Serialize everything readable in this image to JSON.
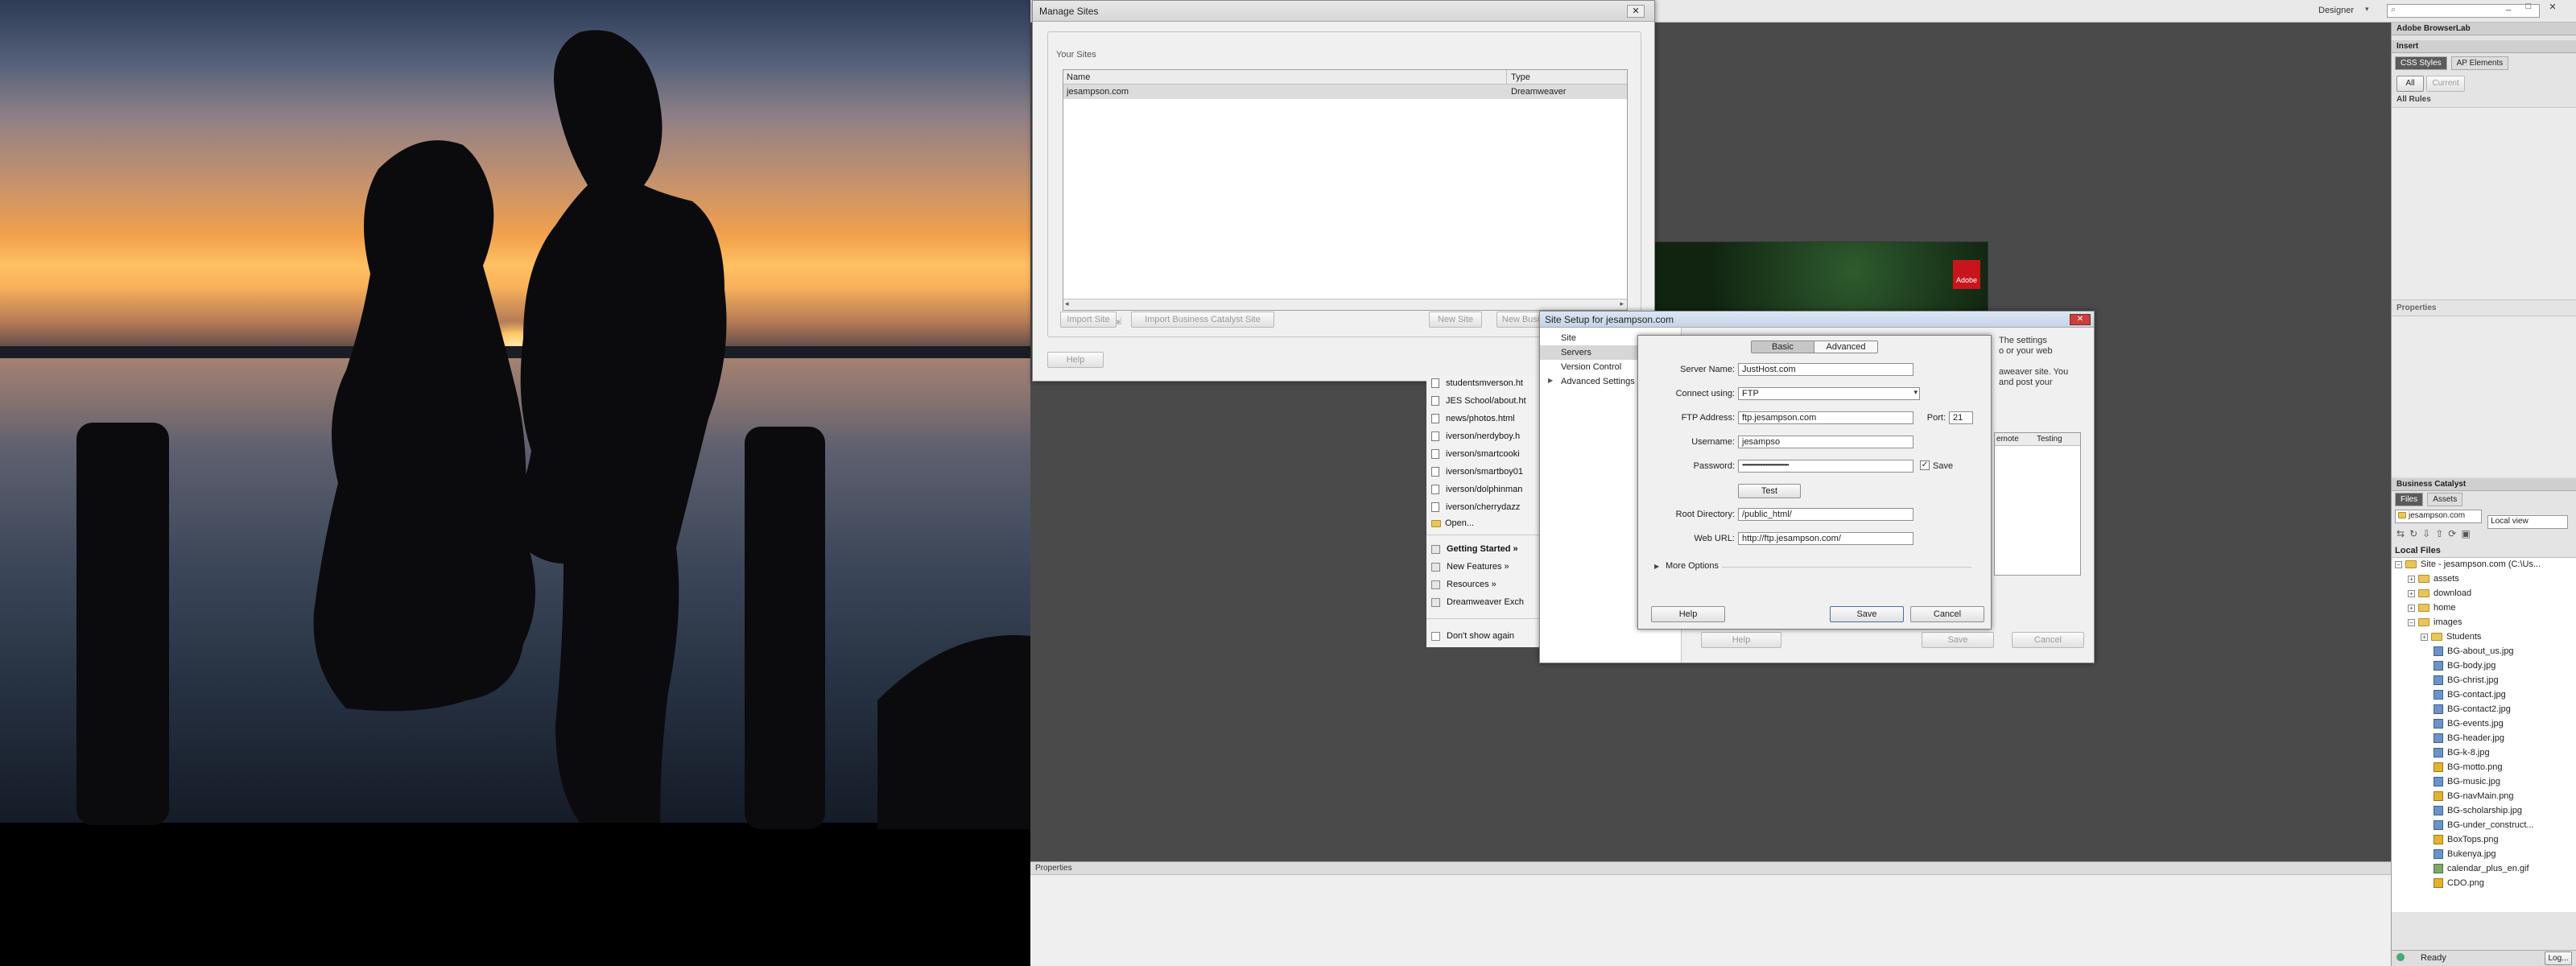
{
  "app": {
    "workspace_label": "Designer",
    "search_placeholder": "",
    "window_controls": [
      "_",
      "□",
      "✕"
    ]
  },
  "right_panel": {
    "browserlab": "Adobe BrowserLab",
    "insert": "Insert",
    "tabs": [
      "CSS Styles",
      "AP Elements"
    ],
    "subtabs": [
      "All",
      "Current"
    ],
    "all_rules": "All Rules",
    "properties": "Properties",
    "business_catalyst": "Business Catalyst",
    "file_tabs": [
      "Files",
      "Assets"
    ],
    "site_select": "jesampson.com",
    "view_select": "Local view",
    "local_files": "Local Files",
    "tree": [
      {
        "label": "Site - jesampson.com (C:\\Us...",
        "type": "site",
        "level": 0
      },
      {
        "label": "assets",
        "type": "folder",
        "level": 1
      },
      {
        "label": "download",
        "type": "folder",
        "level": 1
      },
      {
        "label": "home",
        "type": "folder",
        "level": 1
      },
      {
        "label": "images",
        "type": "folder",
        "level": 1
      },
      {
        "label": "Students",
        "type": "folder",
        "level": 2
      },
      {
        "label": "BG-about_us.jpg",
        "type": "img",
        "level": 2
      },
      {
        "label": "BG-body.jpg",
        "type": "img",
        "level": 2
      },
      {
        "label": "BG-christ.jpg",
        "type": "img",
        "level": 2
      },
      {
        "label": "BG-contact.jpg",
        "type": "img",
        "level": 2
      },
      {
        "label": "BG-contact2.jpg",
        "type": "img",
        "level": 2
      },
      {
        "label": "BG-events.jpg",
        "type": "img",
        "level": 2
      },
      {
        "label": "BG-header.jpg",
        "type": "img",
        "level": 2
      },
      {
        "label": "BG-k-8.jpg",
        "type": "img",
        "level": 2
      },
      {
        "label": "BG-motto.png",
        "type": "png",
        "level": 2
      },
      {
        "label": "BG-music.jpg",
        "type": "img",
        "level": 2
      },
      {
        "label": "BG-navMain.png",
        "type": "png",
        "level": 2
      },
      {
        "label": "BG-scholarship.jpg",
        "type": "img",
        "level": 2
      },
      {
        "label": "BG-under_construct...",
        "type": "img",
        "level": 2
      },
      {
        "label": "BoxTops.png",
        "type": "png",
        "level": 2
      },
      {
        "label": "Bukenya.jpg",
        "type": "img",
        "level": 2
      },
      {
        "label": "calendar_plus_en.gif",
        "type": "gif",
        "level": 2
      },
      {
        "label": "CDO.png",
        "type": "png",
        "level": 2
      }
    ],
    "status": "Ready",
    "log_button": "Log..."
  },
  "properties_panel": {
    "title": "Properties"
  },
  "manage_sites": {
    "title": "Manage Sites",
    "group_label": "Your Sites",
    "columns": [
      "Name",
      "Type"
    ],
    "rows": [
      {
        "name": "jesampson.com",
        "type": "Dreamweaver"
      }
    ],
    "buttons": {
      "import_site": "Import Site",
      "import_bc": "Import Business Catalyst Site",
      "new_site": "New Site",
      "new_bc": "New Busi",
      "help": "Help"
    }
  },
  "welcome_menu": {
    "recent": [
      "studentsmverson.ht",
      "JES School/about.ht",
      "news/photos.html",
      "iverson/nerdyboy.h",
      "iverson/smartcooki",
      "iverson/smartboy01",
      "iverson/dolphinman",
      "iverson/cherrydazz"
    ],
    "open": "Open...",
    "links": [
      "Getting Started »",
      "New Features »",
      "Resources »",
      "Dreamweaver Exch"
    ],
    "dont_show": "Don't show again"
  },
  "background_dialog": {
    "help_text": "The settings\no or your web\n\naweaver site. You\nand post your",
    "tabs": [
      "emote",
      "Testing"
    ],
    "help_button": "Help",
    "save_button": "Save",
    "cancel_button": "Cancel"
  },
  "site_setup": {
    "title": "Site Setup for jesampson.com",
    "nav": [
      "Site",
      "Servers",
      "Version Control",
      "Advanced Settings"
    ]
  },
  "server_dialog": {
    "tabs": [
      "Basic",
      "Advanced"
    ],
    "server_name_label": "Server Name:",
    "server_name": "JustHost.com",
    "connect_label": "Connect using:",
    "connect_value": "FTP",
    "ftp_label": "FTP Address:",
    "ftp_value": "ftp.jesampson.com",
    "port_label": "Port:",
    "port_value": "21",
    "username_label": "Username:",
    "username_value": "jesampso",
    "password_label": "Password:",
    "password_value": "••••••••••••••••••••••••••••••••",
    "save_checkbox_label": "Save",
    "test_button": "Test",
    "root_label": "Root Directory:",
    "root_value": "/public_html/",
    "web_url_label": "Web URL:",
    "web_url_value": "http://ftp.jesampson.com/",
    "more_options": "More Options",
    "help_button": "Help",
    "save_button": "Save",
    "cancel_button": "Cancel"
  },
  "adobe_banner": {
    "logo_text": "Adobe"
  }
}
